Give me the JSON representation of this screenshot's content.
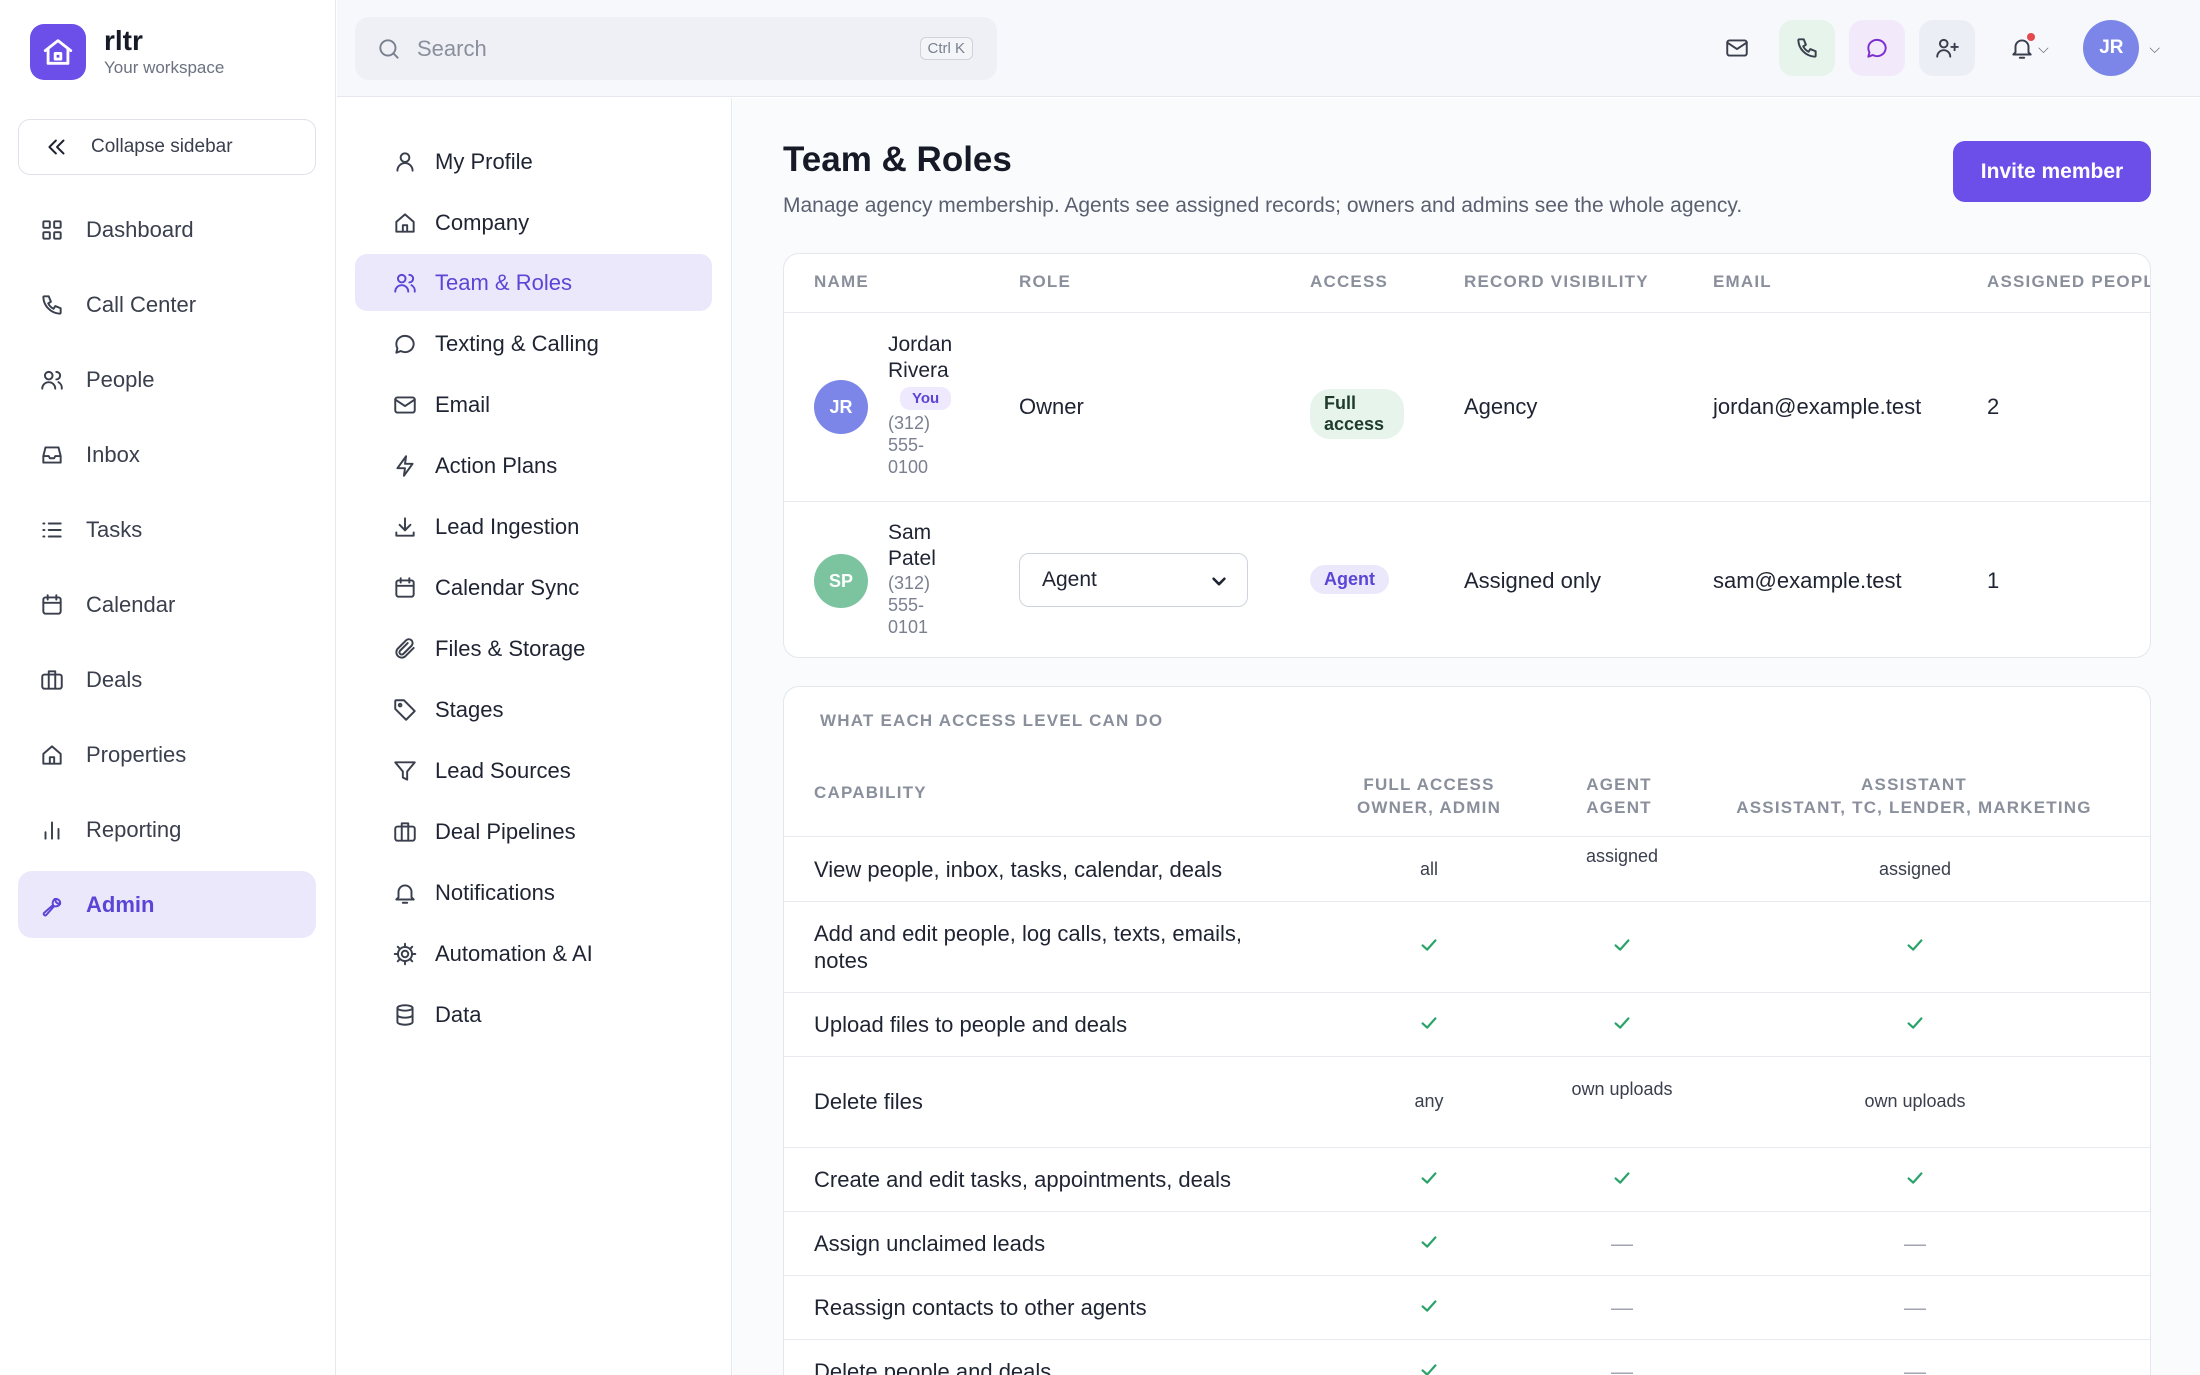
{
  "app": {
    "name": "rltr",
    "workspace": "Your workspace"
  },
  "sidebar": {
    "collapse_label": "Collapse sidebar",
    "items": [
      {
        "label": "Dashboard",
        "icon": "dashboard-icon"
      },
      {
        "label": "Call Center",
        "icon": "phone-icon"
      },
      {
        "label": "People",
        "icon": "people-icon"
      },
      {
        "label": "Inbox",
        "icon": "inbox-icon"
      },
      {
        "label": "Tasks",
        "icon": "list-icon"
      },
      {
        "label": "Calendar",
        "icon": "calendar-icon"
      },
      {
        "label": "Deals",
        "icon": "briefcase-icon"
      },
      {
        "label": "Properties",
        "icon": "home-icon"
      },
      {
        "label": "Reporting",
        "icon": "bar-chart-icon"
      },
      {
        "label": "Admin",
        "icon": "wrench-icon",
        "active": true
      }
    ]
  },
  "topbar": {
    "search_placeholder": "Search",
    "search_shortcut": "Ctrl K",
    "user_initials": "JR"
  },
  "settings_nav": {
    "items": [
      {
        "label": "My Profile",
        "icon": "user-icon"
      },
      {
        "label": "Company",
        "icon": "building-icon"
      },
      {
        "label": "Team & Roles",
        "icon": "team-icon",
        "active": true
      },
      {
        "label": "Texting & Calling",
        "icon": "message-icon"
      },
      {
        "label": "Email",
        "icon": "mail-icon"
      },
      {
        "label": "Action Plans",
        "icon": "lightning-icon"
      },
      {
        "label": "Lead Ingestion",
        "icon": "download-icon"
      },
      {
        "label": "Calendar Sync",
        "icon": "calendar-icon"
      },
      {
        "label": "Files & Storage",
        "icon": "paperclip-icon"
      },
      {
        "label": "Stages",
        "icon": "tag-icon"
      },
      {
        "label": "Lead Sources",
        "icon": "filter-icon"
      },
      {
        "label": "Deal Pipelines",
        "icon": "briefcase-icon"
      },
      {
        "label": "Notifications",
        "icon": "bell-icon"
      },
      {
        "label": "Automation & AI",
        "icon": "gear-icon"
      },
      {
        "label": "Data",
        "icon": "database-icon"
      }
    ]
  },
  "page": {
    "title": "Team & Roles",
    "subtitle": "Manage agency membership. Agents see assigned records; owners and admins see the whole agency.",
    "invite_label": "Invite member"
  },
  "members": {
    "headers": [
      "NAME",
      "ROLE",
      "ACCESS",
      "RECORD VISIBILITY",
      "EMAIL",
      "ASSIGNED PEOPLE"
    ],
    "rows": [
      {
        "initials": "JR",
        "name": "Jordan Rivera",
        "you_badge": "You",
        "phone": "(312) 555-0100",
        "role": "Owner",
        "access": "Full access",
        "visibility": "Agency",
        "email": "jordan@example.test",
        "assigned": "2",
        "avatar_color": "#7b86e8"
      },
      {
        "initials": "SP",
        "name": "Sam Patel",
        "phone": "(312) 555-0101",
        "role": "Agent",
        "access": "Agent",
        "visibility": "Assigned only",
        "email": "sam@example.test",
        "assigned": "1",
        "avatar_color": "#7cc4a0"
      }
    ]
  },
  "permissions": {
    "heading": "WHAT EACH ACCESS LEVEL CAN DO",
    "capability_header": "CAPABILITY",
    "columns": [
      {
        "title": "FULL ACCESS",
        "subtitle": "OWNER, ADMIN"
      },
      {
        "title": "AGENT",
        "subtitle": "AGENT"
      },
      {
        "title": "ASSISTANT",
        "subtitle": "ASSISTANT, TC, LENDER, MARKETING"
      }
    ],
    "rows": [
      {
        "label": "View people, inbox, tasks, calendar, deals",
        "values": [
          "all",
          "assigned",
          "assigned"
        ]
      },
      {
        "label": "Add and edit people, log calls, texts, emails, notes",
        "values": [
          "check",
          "check",
          "check"
        ]
      },
      {
        "label": "Upload files to people and deals",
        "values": [
          "check",
          "check",
          "check"
        ]
      },
      {
        "label": "Delete files",
        "values": [
          "any",
          "own uploads",
          "own uploads"
        ]
      },
      {
        "label": "Create and edit tasks, appointments, deals",
        "values": [
          "check",
          "check",
          "check"
        ]
      },
      {
        "label": "Assign unclaimed leads",
        "values": [
          "check",
          "dash",
          "dash"
        ]
      },
      {
        "label": "Reassign contacts to other agents",
        "values": [
          "check",
          "dash",
          "dash"
        ]
      },
      {
        "label": "Delete people and deals",
        "values": [
          "check",
          "dash",
          "dash"
        ]
      }
    ]
  },
  "colors": {
    "accent": "#6c4ee8",
    "accent_soft": "#ece8fb",
    "check": "#2aa36b"
  }
}
